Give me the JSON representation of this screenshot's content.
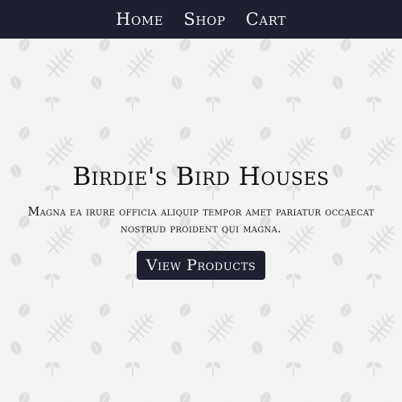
{
  "nav": {
    "items": [
      {
        "label": "Home"
      },
      {
        "label": "Shop"
      },
      {
        "label": "Cart"
      }
    ]
  },
  "hero": {
    "title": "Birdie's Bird Houses",
    "text": "Magna ea irure officia aliquip tempor amet pariatur occaecat nostrud proident qui magna.",
    "button_label": "View Products"
  },
  "colors": {
    "navbar_bg": "#1e2030",
    "page_bg": "#f3f3f3",
    "pattern": "#e1e1e1",
    "button_bg": "#1e2030"
  },
  "background_pattern_icons": [
    "leaf-icon",
    "fern-icon",
    "sprig-icon"
  ]
}
